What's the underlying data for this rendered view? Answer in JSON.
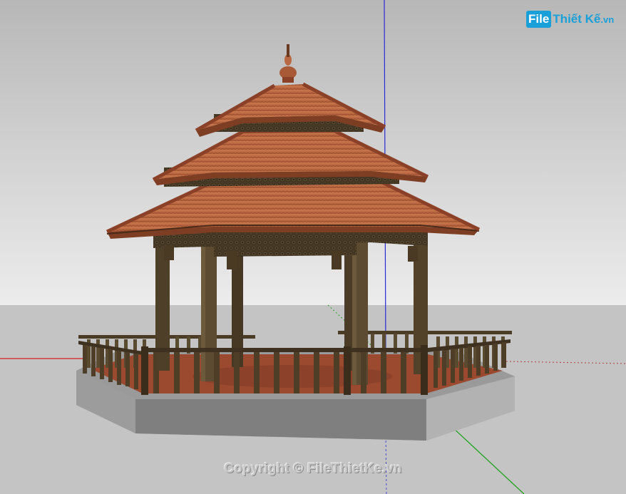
{
  "watermark": {
    "logo_box": "File",
    "logo_rest": "Thiết Kế",
    "logo_tld": ".vn",
    "copyright": "Copyright © FileThietKe.vn"
  },
  "colors": {
    "sky_top": "#bcbcbc",
    "sky_bottom": "#e9e9e9",
    "ground": "#c4c4c4",
    "roof": "#bd6a42",
    "roof_dark": "#8a4128",
    "wood": "#5b4a30",
    "wood_dark": "#3a2d1c",
    "floor": "#9b4a30",
    "base_front": "#8a8a8a",
    "base_side": "#a8a8a8",
    "axis_red": "#d42020",
    "axis_green": "#1fa31f",
    "axis_blue": "#2424d8"
  },
  "scene": {
    "icons": [
      "sketchup-axis-red",
      "sketchup-axis-green",
      "sketchup-axis-blue",
      "gazebo-model"
    ]
  }
}
